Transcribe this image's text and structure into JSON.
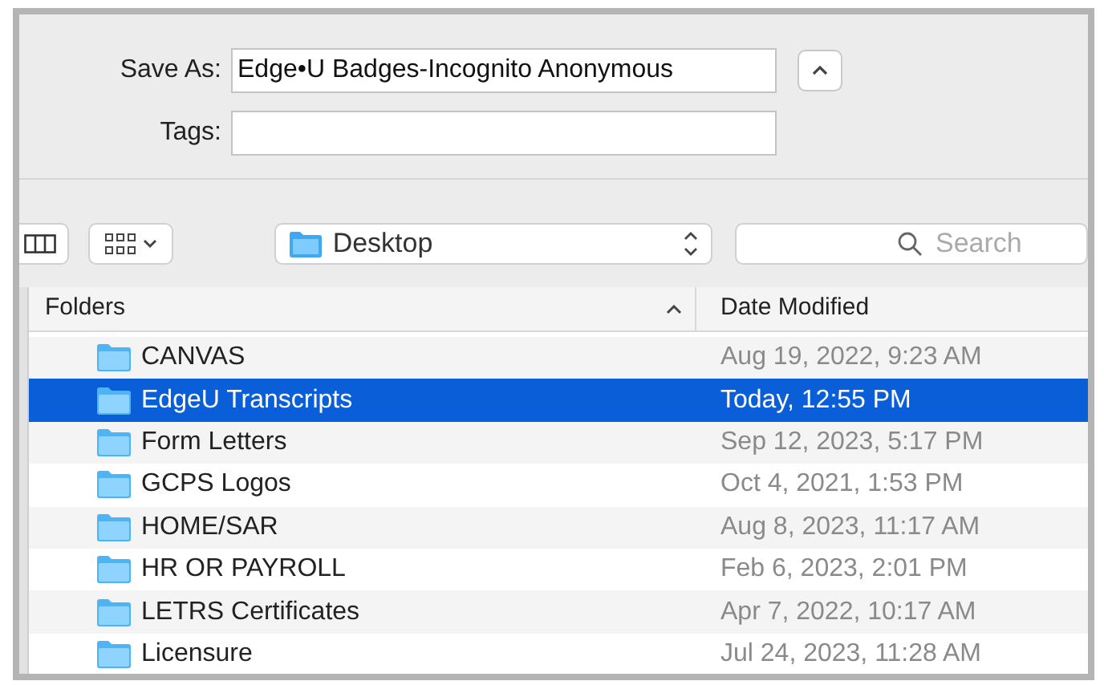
{
  "save_as": {
    "label": "Save As:",
    "value": "Edge•U Badges-Incognito Anonymous"
  },
  "tags": {
    "label": "Tags:"
  },
  "location": {
    "label": "Desktop"
  },
  "search": {
    "placeholder": "Search"
  },
  "table": {
    "columns": [
      "Folders",
      "Date Modified"
    ],
    "rows": [
      {
        "name": "CANVAS",
        "date": "Aug 19, 2022, 9:23 AM",
        "selected": false
      },
      {
        "name": "EdgeU Transcripts",
        "date": "Today, 12:55 PM",
        "selected": true
      },
      {
        "name": "Form Letters",
        "date": "Sep 12, 2023, 5:17 PM",
        "selected": false
      },
      {
        "name": "GCPS Logos",
        "date": "Oct 4, 2021, 1:53 PM",
        "selected": false
      },
      {
        "name": "HOME/SAR",
        "date": "Aug 8, 2023, 11:17 AM",
        "selected": false
      },
      {
        "name": "HR OR PAYROLL",
        "date": "Feb 6, 2023, 2:01 PM",
        "selected": false
      },
      {
        "name": "LETRS Certificates",
        "date": "Apr 7, 2022, 10:17 AM",
        "selected": false
      },
      {
        "name": "Licensure",
        "date": "Jul 24, 2023, 11:28 AM",
        "selected": false
      }
    ]
  }
}
